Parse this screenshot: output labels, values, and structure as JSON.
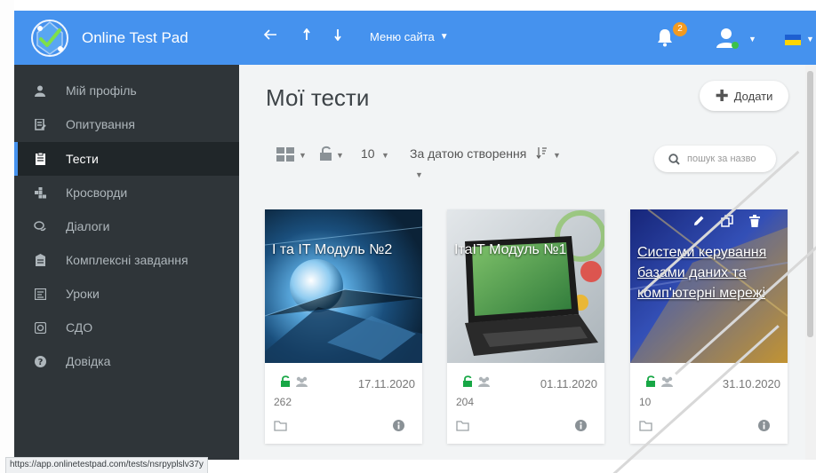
{
  "app": {
    "brand_name": "Online Test Pad"
  },
  "header": {
    "menu_label": "Меню сайта",
    "notification_count": "2",
    "accent_color": "#4592ee",
    "icons": [
      "back-arrow-icon",
      "arrow-up-icon",
      "arrow-down-icon",
      "bell-icon",
      "user-icon",
      "ukraine-flag-icon"
    ]
  },
  "sidebar": {
    "items": [
      {
        "label": "Мій профіль",
        "icon": "user-icon"
      },
      {
        "label": "Опитування",
        "icon": "survey-icon"
      },
      {
        "label": "Тести",
        "icon": "test-icon",
        "active": true
      },
      {
        "label": "Кросворди",
        "icon": "crossword-icon"
      },
      {
        "label": "Діалоги",
        "icon": "dialog-icon"
      },
      {
        "label": "Комплексні завдання",
        "icon": "complex-task-icon"
      },
      {
        "label": "Уроки",
        "icon": "lesson-icon"
      },
      {
        "label": "СДО",
        "icon": "lms-icon"
      },
      {
        "label": "Довідка",
        "icon": "help-icon"
      }
    ]
  },
  "main": {
    "title": "Мої тести",
    "add_label": "Додати",
    "toolbar": {
      "per_page": "10",
      "sort_label": "За датою створення"
    },
    "search": {
      "placeholder": "пошук за назво"
    },
    "cards": [
      {
        "title": "І та ІТ Модуль №2",
        "date": "17.11.2020",
        "count": "262",
        "linked": false
      },
      {
        "title": "ІтаІТ Модуль №1",
        "date": "01.11.2020",
        "count": "204",
        "linked": false
      },
      {
        "title": "Системи керування базами даних та комп'ютерні мережі",
        "date": "31.10.2020",
        "count": "10",
        "linked": true
      }
    ]
  },
  "statusbar": {
    "url": "https://app.onlinetestpad.com/tests/nsrpyplslv37y"
  }
}
